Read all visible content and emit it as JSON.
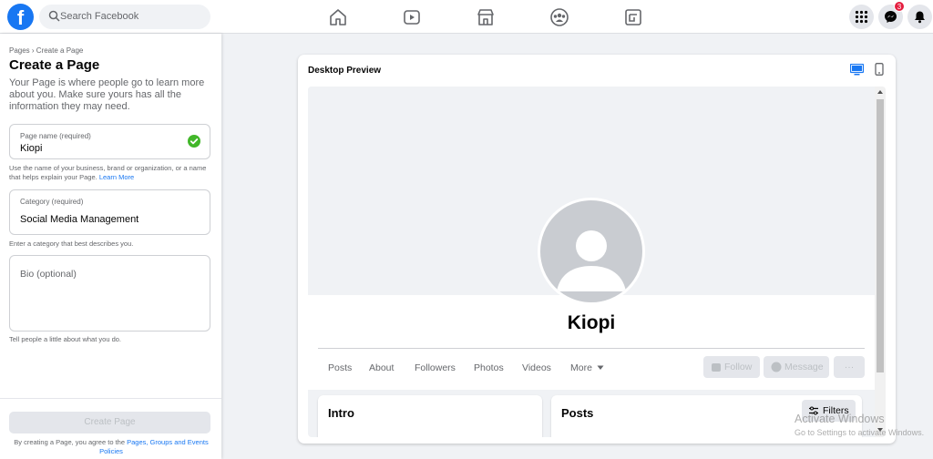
{
  "topbar": {
    "logo": "f",
    "search_placeholder": "Search Facebook",
    "messenger_badge": "3",
    "icons": [
      "home-icon",
      "watch-icon",
      "marketplace-icon",
      "groups-icon",
      "gaming-icon",
      "menu-grid-icon",
      "messenger-icon",
      "notifications-icon"
    ]
  },
  "left": {
    "breadcrumb": "Pages › Create a Page",
    "title": "Create a Page",
    "intro": "Your Page is where people go to learn more about you. Make sure yours has all the information they may need.",
    "page_name": {
      "label": "Page name (required)",
      "value": "Kiopi",
      "helper": "Use the name of your business, brand or organization, or a name that helps explain your Page.",
      "helper_link": "Learn More"
    },
    "category": {
      "label": "Category (required)",
      "value": "Social Media Management",
      "helper": "Enter a category that best describes you."
    },
    "bio": {
      "placeholder": "Bio (optional)",
      "helper": "Tell people a little about what you do."
    },
    "create_button": "Create Page",
    "terms_prefix": "By creating a Page, you agree to the",
    "terms_link": "Pages, Groups and Events Policies"
  },
  "preview": {
    "title": "Desktop Preview",
    "page_name": "Kiopi",
    "tabs": [
      "Posts",
      "About",
      "Followers",
      "Photos",
      "Videos"
    ],
    "more_tab": "More",
    "follow_button": "Follow",
    "message_button": "Message",
    "more_button": "···",
    "intro_title": "Intro",
    "posts_title": "Posts",
    "filters_button": "Filters"
  },
  "watermark": {
    "line1": "Activate Windows",
    "line2": "Go to Settings to activate Windows."
  },
  "colors": {
    "brand": "#1877f2",
    "background": "#f0f2f5",
    "success": "#42b72a",
    "badge": "#e41e3f"
  }
}
